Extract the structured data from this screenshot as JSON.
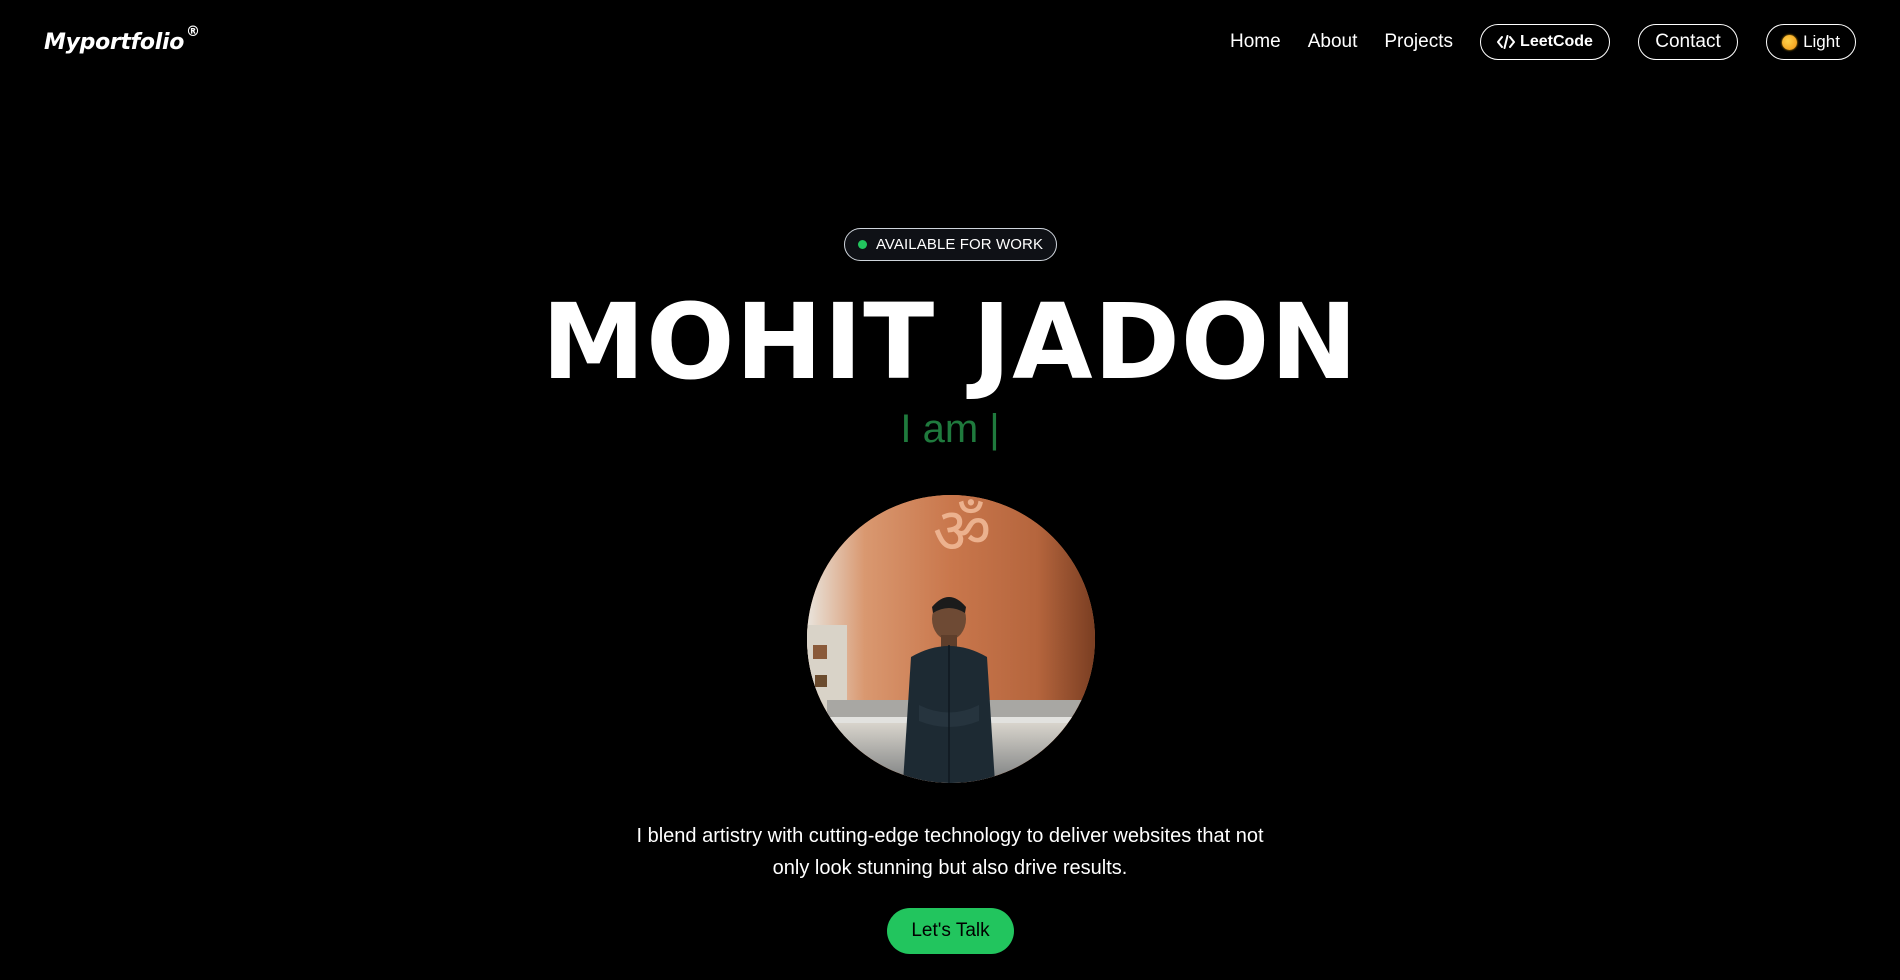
{
  "nav": {
    "logo": "Myportfolio",
    "logo_mark": "®",
    "links": [
      "Home",
      "About",
      "Projects"
    ],
    "leetcode_label": "LeetCode",
    "leetcode_icon": "code-icon",
    "contact_label": "Contact",
    "theme_label": "Light",
    "theme_icon": "sun-icon"
  },
  "hero": {
    "badge_label": "AVAILABLE FOR WORK",
    "name": "MOHIT JADON",
    "typing_text": "I am |",
    "description_line1": "I blend artistry with cutting-edge technology to deliver websites that not",
    "description_line2": "only look stunning but also drive results.",
    "cta_label": "Let's Talk"
  },
  "colors": {
    "background": "#000000",
    "accent": "#22c55e",
    "typing": "#1f7a3d",
    "text": "#ffffff"
  }
}
